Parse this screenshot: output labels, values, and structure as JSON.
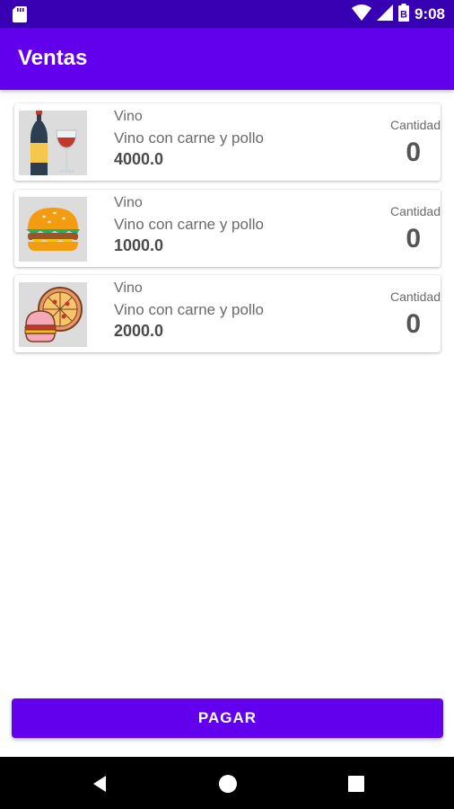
{
  "status_bar": {
    "time": "9:08",
    "battery_glyph": "B",
    "icons": [
      "sd-card-icon",
      "wifi-icon",
      "cell-signal-icon",
      "battery-icon"
    ]
  },
  "app_bar": {
    "title": "Ventas"
  },
  "products": [
    {
      "image": "wine-image",
      "name": "Vino",
      "description": "Vino con carne y pollo",
      "price": "4000.0",
      "quantity_label": "Cantidad",
      "quantity": "0"
    },
    {
      "image": "burger-image",
      "name": "Vino",
      "description": "Vino con carne y pollo",
      "price": "1000.0",
      "quantity_label": "Cantidad",
      "quantity": "0"
    },
    {
      "image": "pizza-burger-image",
      "name": "Vino",
      "description": "Vino con carne y pollo",
      "price": "2000.0",
      "quantity_label": "Cantidad",
      "quantity": "0"
    }
  ],
  "pay_button": {
    "label": "PAGAR"
  },
  "nav_bar": {
    "icons": [
      "back-icon",
      "home-icon",
      "recents-icon"
    ]
  },
  "colors": {
    "primary": "#6200ee",
    "primary_dark": "#3700b3",
    "thumb_bg": "#dcdcdc"
  }
}
